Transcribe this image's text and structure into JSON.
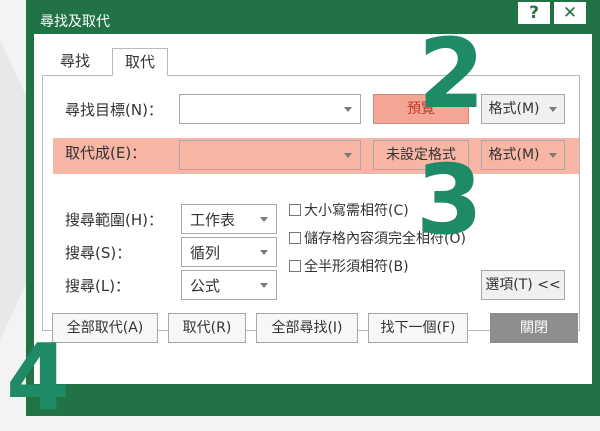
{
  "window": {
    "title": "尋找及取代",
    "help_label": "?",
    "close_label": "✕"
  },
  "tabs": [
    {
      "label": "尋找",
      "active": false
    },
    {
      "label": "取代",
      "active": true
    }
  ],
  "find": {
    "label": "尋找目標(N)：",
    "value": "",
    "preview_label": "預覽",
    "format_label": "格式(M)"
  },
  "replace": {
    "label": "取代成(E)：",
    "value": "",
    "no_format_label": "未設定格式",
    "format_label": "格式(M)"
  },
  "options": {
    "within_label": "搜尋範圍(H)：",
    "within_value": "工作表",
    "search_label": "搜尋(S)：",
    "search_value": "循列",
    "lookin_label": "搜尋(L)：",
    "lookin_value": "公式",
    "match_case": "大小寫需相符(C)",
    "match_entire": "儲存格內容須完全相符(O)",
    "match_byte": "全半形須相符(B)",
    "options_button": "選項(T) <<"
  },
  "buttons": {
    "replace_all": "全部取代(A)",
    "replace": "取代(R)",
    "find_all": "全部尋找(I)",
    "find_next": "找下一個(F)",
    "close": "關閉"
  },
  "callouts": [
    "2",
    "3",
    "4"
  ],
  "colors": {
    "window_green": "#217346",
    "callout_green": "#1e8a66",
    "highlight": "#f7b5a4",
    "salmon_button": "#f4a593"
  }
}
